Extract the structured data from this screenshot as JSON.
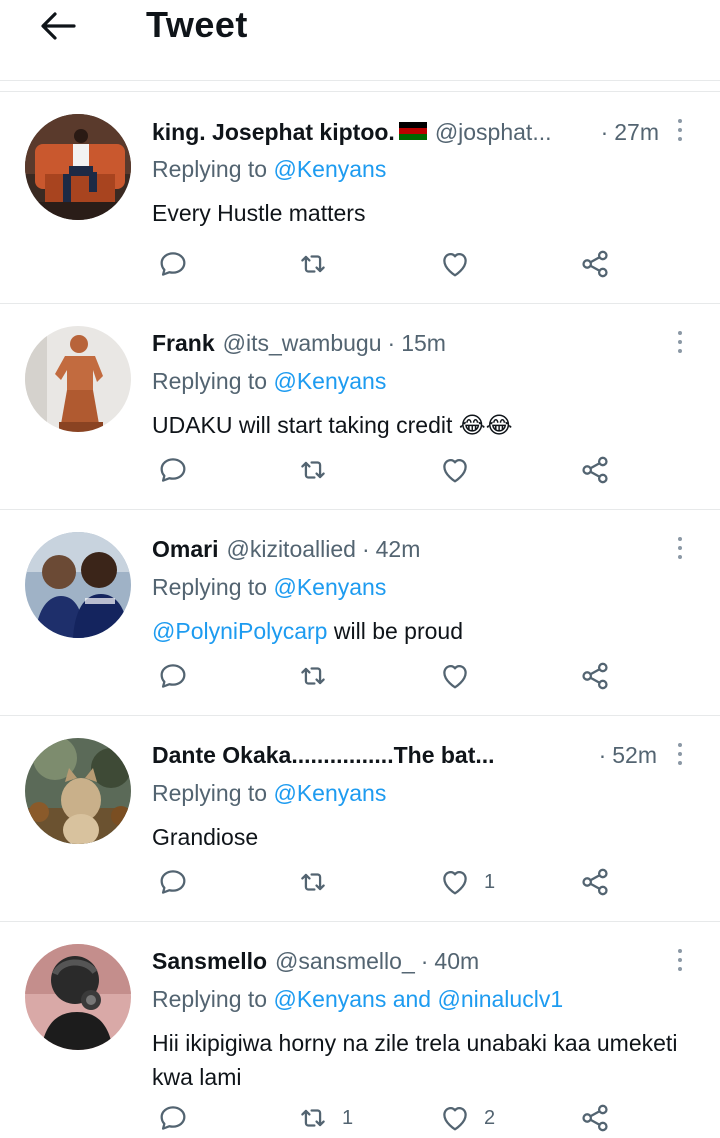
{
  "header": {
    "title": "Tweet"
  },
  "colors": {
    "accent": "#1d9bf0",
    "secondary_text": "#536471",
    "primary_text": "#0f1419"
  },
  "tweets": [
    {
      "name": "king. Josephat kiptoo.",
      "handle": "@josphat...",
      "time": "27m",
      "replying_prefix": "Replying to",
      "replying_to": "@Kenyans",
      "text": "Every Hustle matters",
      "retweet_count": "",
      "like_count": ""
    },
    {
      "name": "Frank",
      "handle": "@its_wambugu",
      "time": "15m",
      "replying_prefix": "Replying to",
      "replying_to": "@Kenyans",
      "text": "UDAKU will start taking credit 😂😂",
      "retweet_count": "",
      "like_count": ""
    },
    {
      "name": "Omari",
      "handle": "@kizitoallied",
      "time": "42m",
      "replying_prefix": "Replying to",
      "replying_to": "@Kenyans",
      "text_mention": "@PolyniPolycarp",
      "text": " will be proud",
      "retweet_count": "",
      "like_count": ""
    },
    {
      "name": "Dante Okaka................The bat...",
      "handle": "",
      "time": "52m",
      "replying_prefix": "Replying to",
      "replying_to": "@Kenyans",
      "text": "Grandiose",
      "retweet_count": "",
      "like_count": "1"
    },
    {
      "name": "Sansmello",
      "handle": "@sansmello_",
      "time": "40m",
      "replying_prefix": "Replying to",
      "replying_to": "@Kenyans and @ninaluclv1",
      "text": "Hii ikipigiwa horny na zile trela unabaki kaa umeketi kwa lami",
      "retweet_count": "1",
      "like_count": "2"
    }
  ]
}
